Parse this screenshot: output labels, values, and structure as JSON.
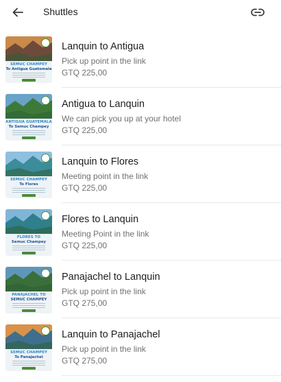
{
  "header": {
    "title": "Shuttles",
    "back_icon": "arrow-left-icon",
    "share_icon": "link-icon"
  },
  "items": [
    {
      "title": "Lanquin to Antigua",
      "subtitle": "Pick up point in the link",
      "price": "GTQ 225,00",
      "thumb_line1": "SEMUC CHAMPEY",
      "thumb_line2": "To Antigua Guatemala",
      "sky": "#c98a4a",
      "land": "#6e4a3a"
    },
    {
      "title": "Antigua to Lanquin",
      "subtitle": "We can pick you up at your hotel",
      "price": "GTQ 225,00",
      "thumb_line1": "ANTIGUA GUATEMALA",
      "thumb_line2": "To Semuc Champey",
      "sky": "#6aa3c7",
      "land": "#3d7a3a"
    },
    {
      "title": "Lanquin to Flores",
      "subtitle": "Meeting point in the link",
      "price": "GTQ 225,00",
      "thumb_line1": "SEMUC CHAMPEY",
      "thumb_line2": "To Flores",
      "sky": "#8fc0e0",
      "land": "#3c8c9a"
    },
    {
      "title": "Flores to Lanquin",
      "subtitle": "Meeting Point in the link",
      "price": "GTQ 225,00",
      "thumb_line1": "FLORES TO",
      "thumb_line2": "Semuc Champey",
      "sky": "#7fb6d8",
      "land": "#2f7f8c"
    },
    {
      "title": "Panajachel to Lanquin",
      "subtitle": "Pick up point in the link",
      "price": "GTQ 275,00",
      "thumb_line1": "PANAJACHEL TO",
      "thumb_line2": "SEMUC CHAMPEY",
      "sky": "#5f96b8",
      "land": "#3a6e3a"
    },
    {
      "title": "Lanquin to Panajachel",
      "subtitle": "Pick up point in the link",
      "price": "GTQ 275,00",
      "thumb_line1": "SEMUC CHAMPEY",
      "thumb_line2": "To Panajachel",
      "sky": "#d9924a",
      "land": "#3f6f8c"
    }
  ]
}
